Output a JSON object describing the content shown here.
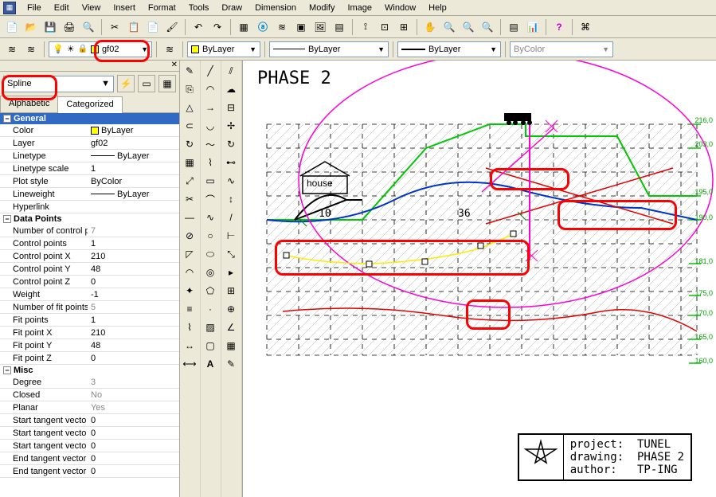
{
  "app_icon": "▦",
  "menu": [
    "File",
    "Edit",
    "View",
    "Insert",
    "Format",
    "Tools",
    "Draw",
    "Dimension",
    "Modify",
    "Image",
    "Window",
    "Help"
  ],
  "toolbar2": {
    "layer_name": "gf02",
    "bylayer1": "ByLayer",
    "linetype": "ByLayer",
    "lineweight": "ByLayer",
    "bycolor": "ByColor"
  },
  "properties": {
    "entity_type": "Spline",
    "tabs": {
      "alphabetic": "Alphabetic",
      "categorized": "Categorized"
    },
    "cats": {
      "general": "General",
      "data_points": "Data Points",
      "misc": "Misc"
    },
    "rows": {
      "color_k": "Color",
      "color_v": "ByLayer",
      "layer_k": "Layer",
      "layer_v": "gf02",
      "linetype_k": "Linetype",
      "linetype_v": "ByLayer",
      "ltscale_k": "Linetype scale",
      "ltscale_v": "1",
      "plot_k": "Plot style",
      "plot_v": "ByColor",
      "lw_k": "Lineweight",
      "lw_v": "ByLayer",
      "hyper_k": "Hyperlink",
      "hyper_v": "",
      "ncp_k": "Number of control p",
      "ncp_v": "7",
      "cp_k": "Control points",
      "cp_v": "1",
      "cpx_k": "Control point X",
      "cpx_v": "210",
      "cpy_k": "Control point Y",
      "cpy_v": "48",
      "cpz_k": "Control point Z",
      "cpz_v": "0",
      "w_k": "Weight",
      "w_v": "-1",
      "nfp_k": "Number of fit points",
      "nfp_v": "5",
      "fp_k": "Fit points",
      "fp_v": "1",
      "fpx_k": "Fit point X",
      "fpx_v": "210",
      "fpy_k": "Fit point Y",
      "fpy_v": "48",
      "fpz_k": "Fit point Z",
      "fpz_v": "0",
      "deg_k": "Degree",
      "deg_v": "3",
      "closed_k": "Closed",
      "closed_v": "No",
      "planar_k": "Planar",
      "planar_v": "Yes",
      "stvx_k": "Start tangent vecto",
      "stvx_v": "0",
      "stvy_k": "Start tangent vecto",
      "stvy_v": "0",
      "stvz_k": "Start tangent vecto",
      "stvz_v": "0",
      "etvx_k": "End tangent vector",
      "etvx_v": "0",
      "etvy_k": "End tangent vector",
      "etvy_v": "0"
    }
  },
  "drawing": {
    "title": "PHASE 2",
    "house_label": "house",
    "dim_10": "10",
    "dim_36": "36",
    "elevations": [
      "216,0",
      "203,0",
      "195,0",
      "190,0",
      "181,0",
      "175,0",
      "170,0",
      "165,0",
      "160,0"
    ],
    "tb_project_k": "project:",
    "tb_project_v": "TUNEL",
    "tb_drawing_k": "drawing:",
    "tb_drawing_v": "PHASE 2",
    "tb_author_k": "author:",
    "tb_author_v": "TP-ING"
  }
}
